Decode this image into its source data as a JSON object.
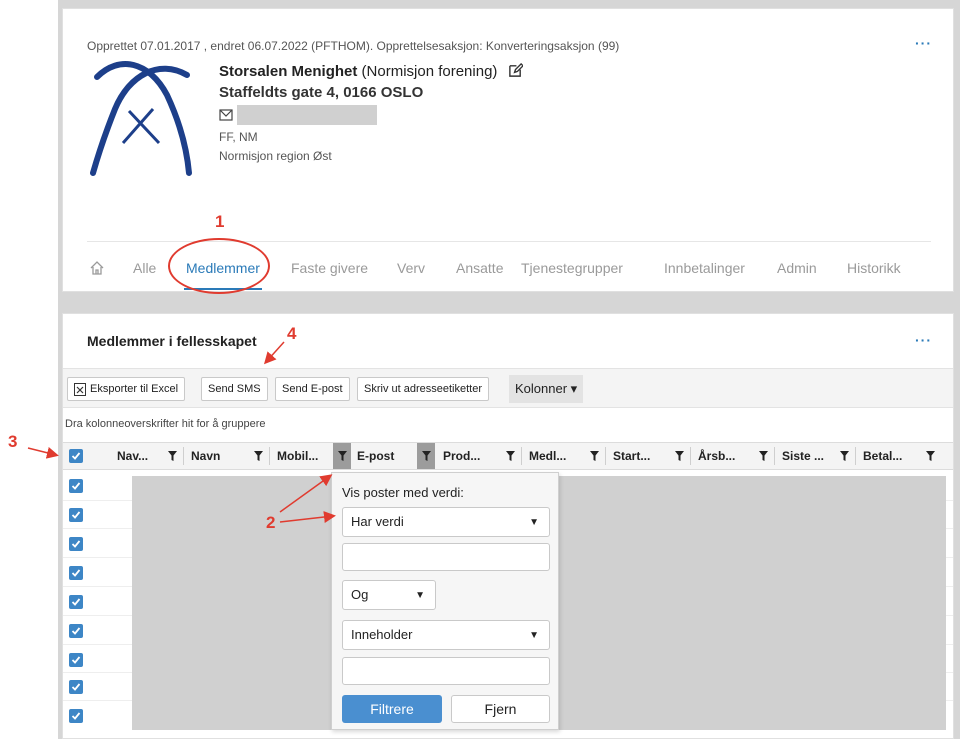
{
  "org": {
    "meta": "Opprettet 07.01.2017 , endret 06.07.2022 (PFTHOM). Opprettelsesaksjon: Konverteringsaksjon (99)",
    "name": "Storsalen Menighet",
    "type": "(Normisjon forening)",
    "address": "Staffeldts gate 4, 0166 OSLO",
    "tags": "FF, NM",
    "region": "Normisjon region Øst",
    "more": "···"
  },
  "tabs": [
    "Alle",
    "Medlemmer",
    "Faste givere",
    "Verv",
    "Ansatte",
    "Tjenestegrupper",
    "Innbetalinger",
    "Admin",
    "Historikk"
  ],
  "section": {
    "title": "Medlemmer i fellesskapet",
    "more": "···"
  },
  "toolbar": {
    "export": "Eksporter til Excel",
    "sms": "Send SMS",
    "email": "Send E-post",
    "labels": "Skriv ut adresseetiketter",
    "columns": "Kolonner ▾"
  },
  "grid": {
    "group_hint": "Dra kolonneoverskrifter hit for å gruppere",
    "columns": [
      "Nav...",
      "Navn",
      "Mobil...",
      "E-post",
      "Prod...",
      "Medl...",
      "Start...",
      "Årsb...",
      "Siste ...",
      "Betal..."
    ]
  },
  "filter": {
    "label": "Vis poster med verdi:",
    "operator1": "Har verdi",
    "logic": "Og",
    "operator2": "Inneholder",
    "apply": "Filtrere",
    "clear": "Fjern"
  },
  "annotations": [
    "1",
    "2",
    "3",
    "4"
  ],
  "colors": {
    "accent": "#2a7ab8",
    "annotation": "#e03b2f",
    "button": "#4a8fd0"
  }
}
